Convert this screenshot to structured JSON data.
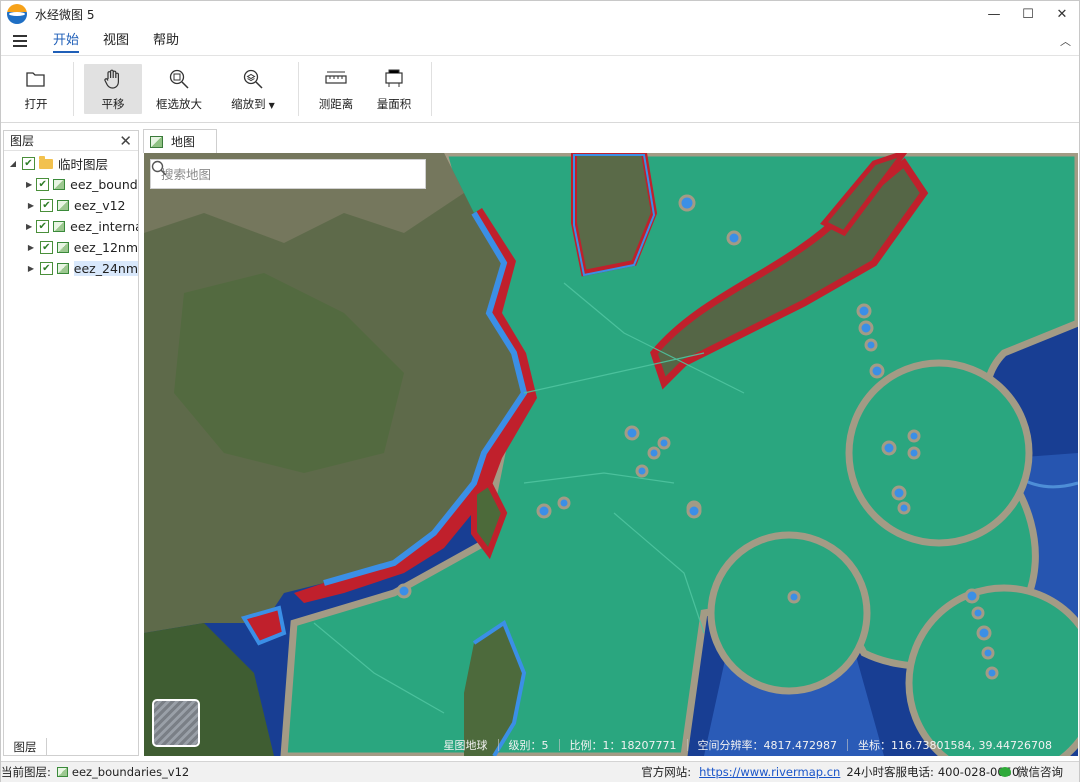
{
  "window": {
    "title": "水经微图 5"
  },
  "menu": {
    "tabs": [
      "开始",
      "视图",
      "帮助"
    ],
    "active": "开始"
  },
  "ribbon": {
    "open": "打开",
    "pan": "平移",
    "box_zoom": "框选放大",
    "zoom_to": "缩放到",
    "measure_distance": "测距离",
    "measure_area": "量面积"
  },
  "layer_panel": {
    "title": "图层",
    "root": "临时图层",
    "layers": [
      "eez_boundaries",
      "eez_v12",
      "eez_internal",
      "eez_12nm",
      "eez_24nm"
    ],
    "bottom_tab": "图层"
  },
  "doc_tab": {
    "label": "地图"
  },
  "map": {
    "search_placeholder": "搜索地图",
    "basemap": "星图地球",
    "level_label": "级别：",
    "level": "5",
    "scale_label": "比例：",
    "scale": "1：18207771",
    "resolution_label": "空间分辨率：",
    "resolution": "4817.472987",
    "coord_label": "坐标：",
    "coords": "116.73801584, 39.44726708"
  },
  "statusbar": {
    "current_layer_label": "当前图层:",
    "current_layer": "eez_boundaries_v12",
    "website_label": "官方网站:",
    "website": "https://www.rivermap.cn",
    "hotline_label": "24小时客服电话:",
    "hotline": "400-028-0050",
    "wechat": "微信咨询"
  },
  "colors": {
    "eez_fill": "#2aa77e",
    "coastal_12nm": "#c0202c",
    "contiguous_24nm": "#3b8fe6",
    "border": "#a29a84",
    "ocean": "#173f92"
  }
}
